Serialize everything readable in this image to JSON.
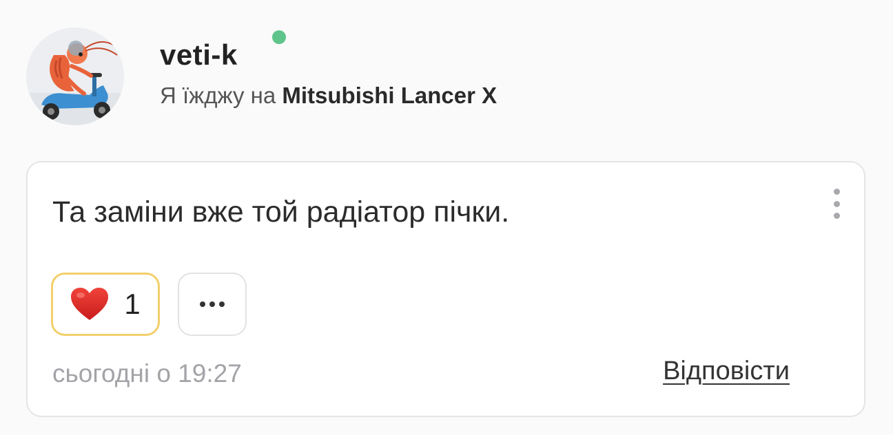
{
  "author": {
    "avatar_icon": "shrimp-on-scooter-avatar",
    "username": "veti-k",
    "online_status_color": "#5ec48a",
    "drives_prefix": "Я їжджу на",
    "car": "Mitsubishi Lancer X"
  },
  "comment": {
    "text": "Та заміни вже той радіатор пічки.",
    "menu_icon": "more-vertical-icon",
    "reactions": [
      {
        "emoji": "❤️",
        "icon": "red-heart-icon",
        "count": "1",
        "selected": true,
        "border_color": "#f2cf6b"
      }
    ],
    "more_reactions_icon": "more-horizontal-icon",
    "timestamp": "сьогодні о 19:27",
    "reply_label": "Відповісти"
  }
}
